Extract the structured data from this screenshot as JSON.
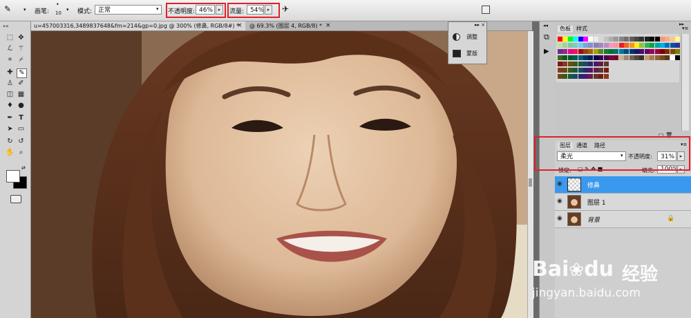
{
  "options_bar": {
    "brush_label": "画笔:",
    "brush_size": "10",
    "mode_label": "模式:",
    "mode_value": "正常",
    "opacity_label": "不透明度:",
    "opacity_value": "46%",
    "flow_label": "流量:",
    "flow_value": "54%"
  },
  "tabs": [
    {
      "label": "u=457003316,3489837648&fm=214&gp=0.jpg @ 300% (修鼻, RGB/8#) *",
      "close": "×",
      "active": true
    },
    {
      "label": "@ 69.3% (图层 4, RGB/8) *",
      "close": "×",
      "active": false
    }
  ],
  "adjust_panel": {
    "items": [
      "调整",
      "蒙版"
    ]
  },
  "swatches_panel": {
    "tabs": [
      "色板",
      "样式"
    ]
  },
  "layers_panel": {
    "tabs": [
      "图层",
      "通道",
      "路径"
    ],
    "blend_mode": "柔光",
    "opacity_label": "不透明度:",
    "opacity_value": "31%",
    "lock_label": "锁定:",
    "fill_label": "填充:",
    "fill_value": "100%",
    "layers": [
      {
        "name": "修鼻",
        "selected": true
      },
      {
        "name": "图层 1",
        "selected": false
      },
      {
        "name": "背景",
        "selected": false
      }
    ]
  },
  "watermark": {
    "brand": "Bai",
    "brand_tail": "du",
    "cn": "经验",
    "url": "jingyan.baidu.com"
  },
  "colors": {
    "highlight_red": "#e0202a",
    "selected_layer": "#3a99ef",
    "panel_gray": "#c6c6c6"
  }
}
